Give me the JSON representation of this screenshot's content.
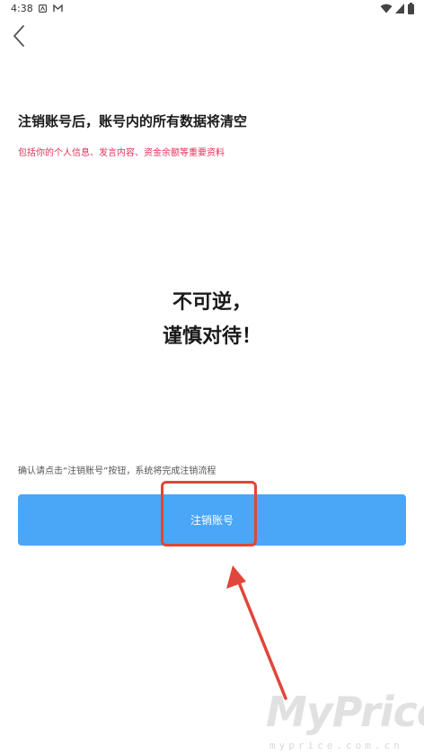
{
  "status_bar": {
    "time": "4:38",
    "icons": [
      "notification-a-icon",
      "notification-m-icon",
      "wifi-icon",
      "signal-icon",
      "battery-icon"
    ]
  },
  "nav": {
    "back_icon": "chevron-left-icon"
  },
  "content": {
    "title": "注销账号后，账号内的所有数据将清空",
    "subtitle": "包括你的个人信息、发言内容、资金余额等重要资料",
    "warning_line1": "不可逆，",
    "warning_line2": "谨慎对待！",
    "confirm_hint": "确认请点击“注销账号”按钮，系统将完成注销流程"
  },
  "action": {
    "cancel_account_label": "注销账号"
  },
  "colors": {
    "button_bg": "#4aa6f7",
    "subtitle_text": "#e0325a",
    "annotation_red": "#e0463a"
  },
  "watermark": {
    "main": "MyPrice",
    "sub": "myprice.com.cn"
  }
}
